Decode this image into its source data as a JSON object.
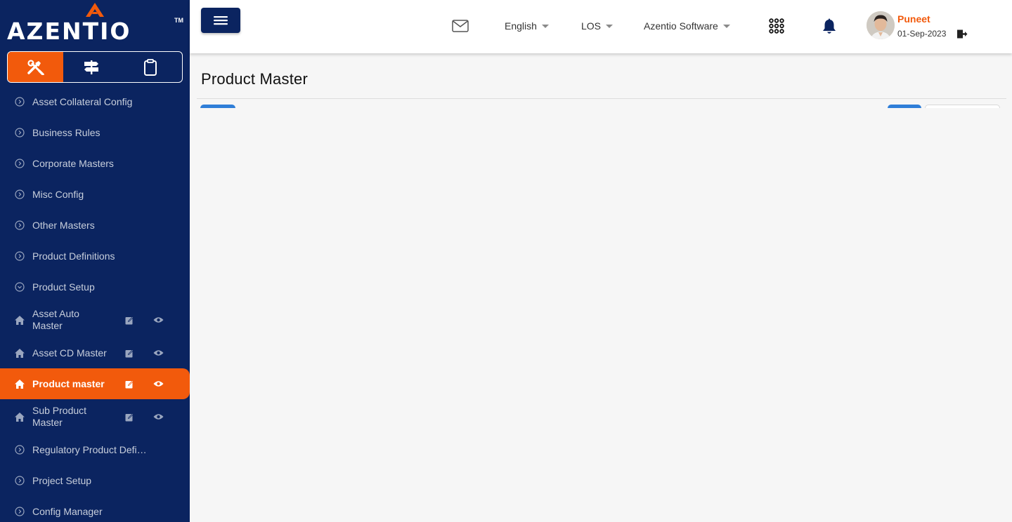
{
  "brand": {
    "logo_text": "AZENTIO",
    "trademark": "TM"
  },
  "sidebar": {
    "mode_tabs": [
      {
        "icon": "tools-icon",
        "active": true
      },
      {
        "icon": "signpost-icon",
        "active": false
      },
      {
        "icon": "clipboard-icon",
        "active": false
      }
    ],
    "items": [
      {
        "label": "Asset Collateral Config",
        "icon": "chevron-circle-right-icon"
      },
      {
        "label": "Business Rules",
        "icon": "chevron-circle-right-icon"
      },
      {
        "label": "Corporate Masters",
        "icon": "chevron-circle-right-icon"
      },
      {
        "label": "Misc Config",
        "icon": "chevron-circle-right-icon"
      },
      {
        "label": "Other Masters",
        "icon": "chevron-circle-right-icon"
      },
      {
        "label": "Product Definitions",
        "icon": "chevron-circle-right-icon"
      },
      {
        "label": "Product Setup",
        "icon": "chevron-circle-down-icon"
      },
      {
        "label": "Asset Auto Master",
        "icon": "home-icon"
      },
      {
        "label": "Asset CD Master",
        "icon": "home-icon"
      },
      {
        "label": "Product master",
        "icon": "home-icon"
      },
      {
        "label": "Sub Product Master",
        "icon": "home-icon"
      },
      {
        "label": "Regulatory Product Defini...",
        "icon": "chevron-circle-right-icon"
      },
      {
        "label": "Project Setup",
        "icon": "chevron-circle-right-icon"
      },
      {
        "label": "Config Manager",
        "icon": "chevron-circle-right-icon"
      }
    ]
  },
  "header": {
    "language": "English",
    "module": "LOS",
    "organization": "Azentio Software",
    "user_name": "Puneet",
    "user_date": "01-Sep-2023"
  },
  "main": {
    "page_title": "Product Master"
  },
  "colors": {
    "sidebar_bg": "#0b2460",
    "accent": "#f25a0c",
    "tab_blue": "#2f7ed8"
  }
}
